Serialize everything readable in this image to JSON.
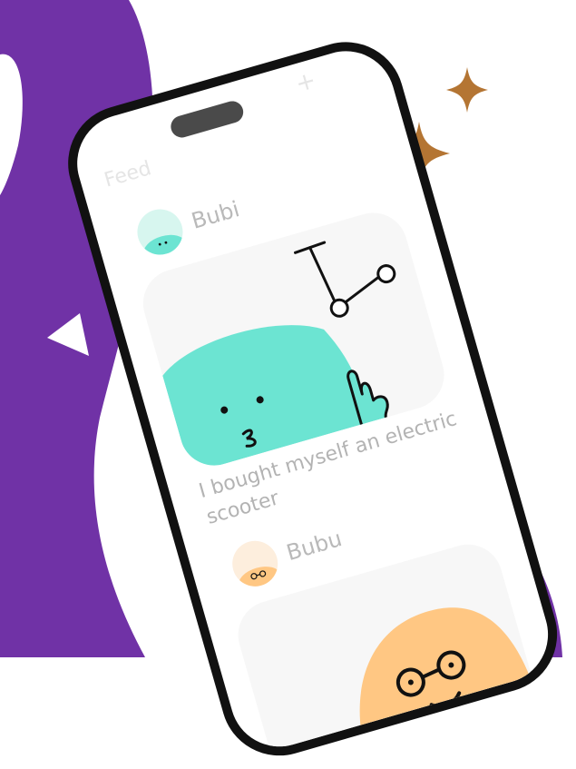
{
  "feed": {
    "title": "Feed",
    "add_label": "+"
  },
  "posts": [
    {
      "author": "Bubi",
      "avatar": "green-blob-avatar",
      "caption": "I bought myself an electric scooter",
      "illustration": "green-blob-with-scooter"
    },
    {
      "author": "Bubu",
      "avatar": "orange-blob-with-glasses-avatar",
      "illustration": "orange-blob-with-glasses"
    }
  ],
  "colors": {
    "background_shape": "#7032a6",
    "sparkle": "#b47533",
    "bubi_blob": "#6ce4d2",
    "bubu_blob": "#ffc783",
    "phone_frame": "#111111"
  }
}
